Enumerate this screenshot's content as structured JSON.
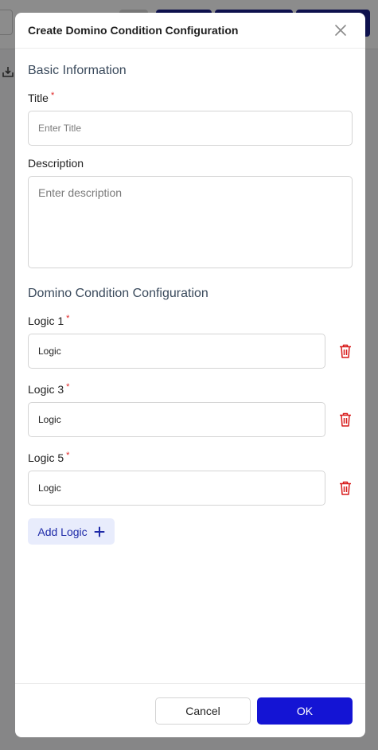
{
  "modal": {
    "title": "Create Domino Condition Configuration",
    "close_icon": "close-icon"
  },
  "basic_info": {
    "heading": "Basic Information",
    "title_label": "Title",
    "title_required": "*",
    "title_placeholder": "Enter Title",
    "title_value": "",
    "description_label": "Description",
    "description_placeholder": "Enter description",
    "description_value": ""
  },
  "domino": {
    "heading": "Domino Condition Configuration",
    "logics": [
      {
        "label": "Logic 1",
        "required": "*",
        "value": "Logic",
        "delete_icon": "trash-icon"
      },
      {
        "label": "Logic 3",
        "required": "*",
        "value": "Logic",
        "delete_icon": "trash-icon"
      },
      {
        "label": "Logic 5",
        "required": "*",
        "value": "Logic",
        "delete_icon": "trash-icon"
      }
    ],
    "add_label": "Add Logic",
    "add_icon": "plus-icon"
  },
  "footer": {
    "cancel_label": "Cancel",
    "ok_label": "OK"
  },
  "colors": {
    "primary": "#1414d4",
    "required": "#e02424",
    "delete": "#d81b1b",
    "add_bg": "#e8ecfc",
    "add_text": "#1e2aa8"
  }
}
